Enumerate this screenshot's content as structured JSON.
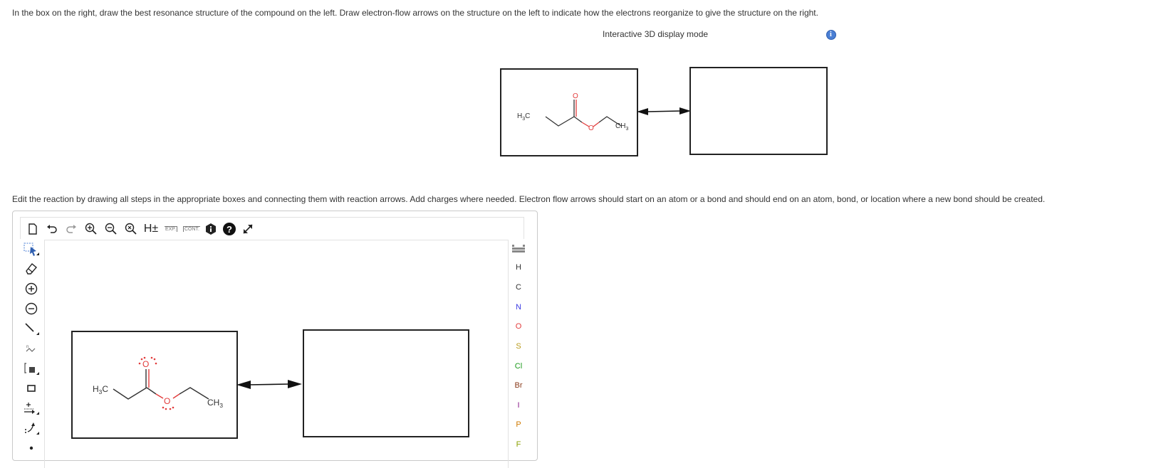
{
  "instructions": {
    "line1": "In the box on the right, draw the best resonance structure of the compound on the left. Draw electron-flow arrows on the structure on the left to indicate how the electrons reorganize to give the structure on the right.",
    "display_mode": "Interactive 3D display mode",
    "line2": "Edit the reaction by drawing all steps in the appropriate boxes and connecting them with reaction arrows. Add charges where needed. Electron flow arrows should start on an atom or a bond and should end on an atom, bond, or location where a new bond should be created."
  },
  "molecule": {
    "left_group": "H3C",
    "right_group": "CH3",
    "carbonyl_o": "O",
    "ester_o": "O"
  },
  "toolbar": {
    "h_label": "H±",
    "exp_label": "EXP.",
    "cont_label": "CONT."
  },
  "elements": [
    "H",
    "C",
    "N",
    "O",
    "S",
    "Cl",
    "Br",
    "I",
    "P",
    "F"
  ],
  "colors": {
    "oxygen": "#e23b3b",
    "nitrogen": "#3b3be2",
    "sulfur": "#b89a1a",
    "chlorine": "#1a9a1a",
    "bromine": "#8a3a1a",
    "iodine": "#8a1a8a",
    "phosphorus": "#d07a00",
    "fluorine": "#8aa000",
    "accent": "#4a7fd4"
  }
}
